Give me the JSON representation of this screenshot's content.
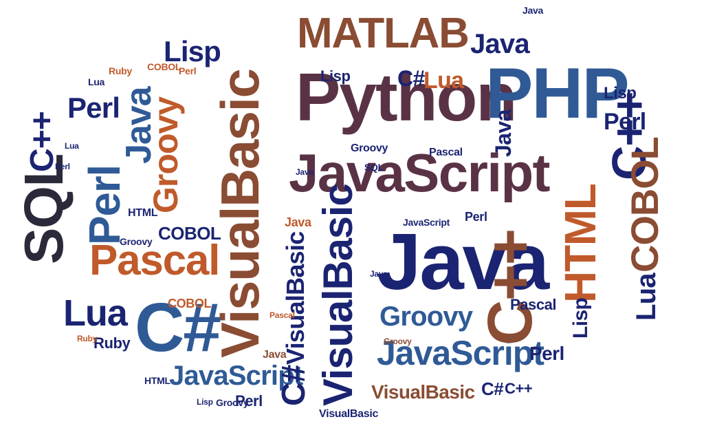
{
  "words": [
    "Python",
    "PHP",
    "MATLAB",
    "Java",
    "JavaScript",
    "JavaScript",
    "JavaScript",
    "JavaScript",
    "VisualBasic",
    "VisualBasic",
    "VisualBasic",
    "VisualBasic",
    "VisualBasic",
    "C#",
    "C#",
    "C#",
    "C#",
    "C++",
    "C++",
    "C++",
    "C++",
    "HTML",
    "HTML",
    "HTML",
    "COBOL",
    "COBOL",
    "COBOL",
    "COBOL",
    "SQL",
    "SQL",
    "Perl",
    "Perl",
    "Perl",
    "Perl",
    "Perl",
    "Perl",
    "Perl",
    "Perl",
    "Groovy",
    "Groovy",
    "Groovy",
    "Groovy",
    "Groovy",
    "Groovy",
    "Pascal",
    "Pascal",
    "Pascal",
    "Pascal",
    "Lua",
    "Lua",
    "Lua",
    "Lua",
    "Lua",
    "Lisp",
    "Lisp",
    "Lisp",
    "Lisp",
    "Lisp",
    "Ruby",
    "Ruby",
    "Ruby",
    "Java",
    "Java",
    "Java",
    "Java",
    "Java",
    "Java",
    "Java",
    "Java"
  ],
  "colors": {
    "navy": "#1b2472",
    "blue": "#2f5a96",
    "orange": "#c05a2b",
    "brown": "#8a4c33",
    "plum": "#5a3246"
  }
}
